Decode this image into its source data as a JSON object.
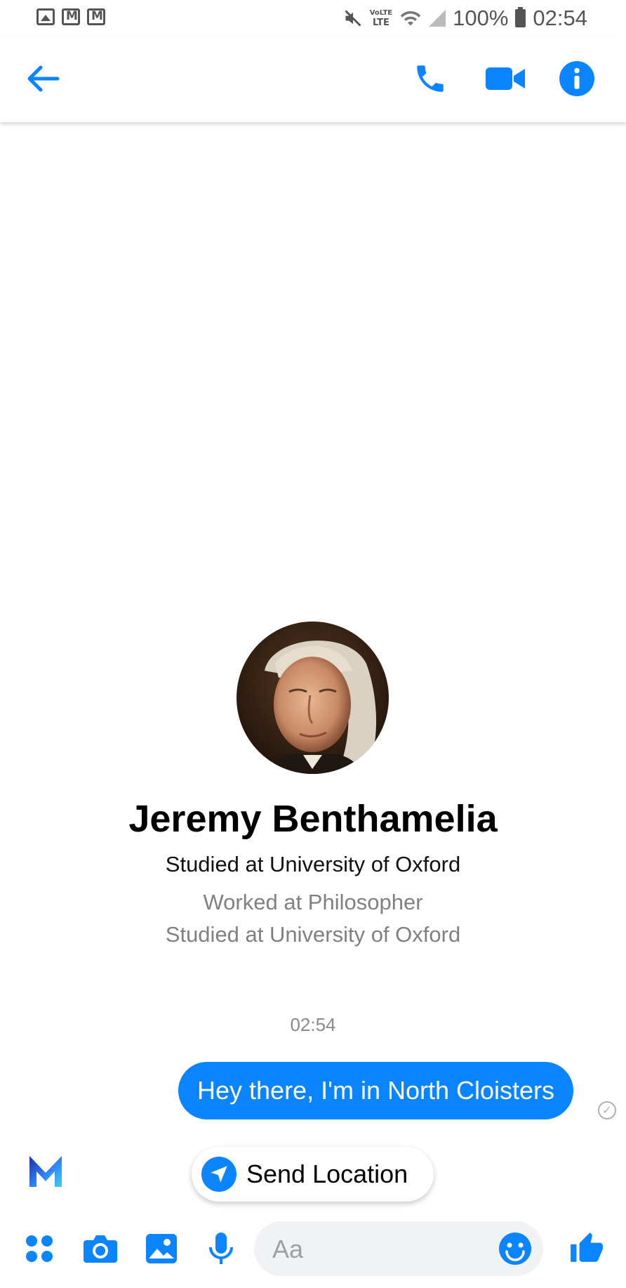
{
  "status_bar": {
    "battery": "100%",
    "time": "02:54",
    "volte": "VoLTE",
    "lte": "LTE",
    "notification_icons": [
      "image-icon",
      "gmail-icon",
      "gmail-icon"
    ],
    "right_icons": [
      "mute-icon",
      "volte-icon",
      "wifi-icon",
      "signal-icon",
      "battery-icon"
    ]
  },
  "app_bar": {
    "icons": [
      "back-arrow-icon",
      "phone-icon",
      "video-camera-icon",
      "info-icon"
    ]
  },
  "profile": {
    "name": "Jeremy Benthamelia",
    "subtitle": "Studied at University of Oxford",
    "detail_work": "Worked at Philosopher",
    "detail_study": "Studied at University of Oxford"
  },
  "conversation": {
    "timestamp": "02:54",
    "messages": [
      {
        "text": "Hey there, I'm in North Cloisters",
        "sender": "me",
        "status": "sent"
      }
    ]
  },
  "suggestion": {
    "label": "Send Location",
    "icon": "location-arrow-icon",
    "assistant_icon": "m-assistant-icon"
  },
  "composer": {
    "placeholder": "Aa",
    "icons": [
      "more-apps-icon",
      "camera-icon",
      "gallery-icon",
      "microphone-icon",
      "emoji-icon",
      "thumbs-up-icon"
    ]
  },
  "colors": {
    "accent": "#0a84ff",
    "secondary_text": "#808080",
    "composer_bg": "#f1f2f4"
  }
}
